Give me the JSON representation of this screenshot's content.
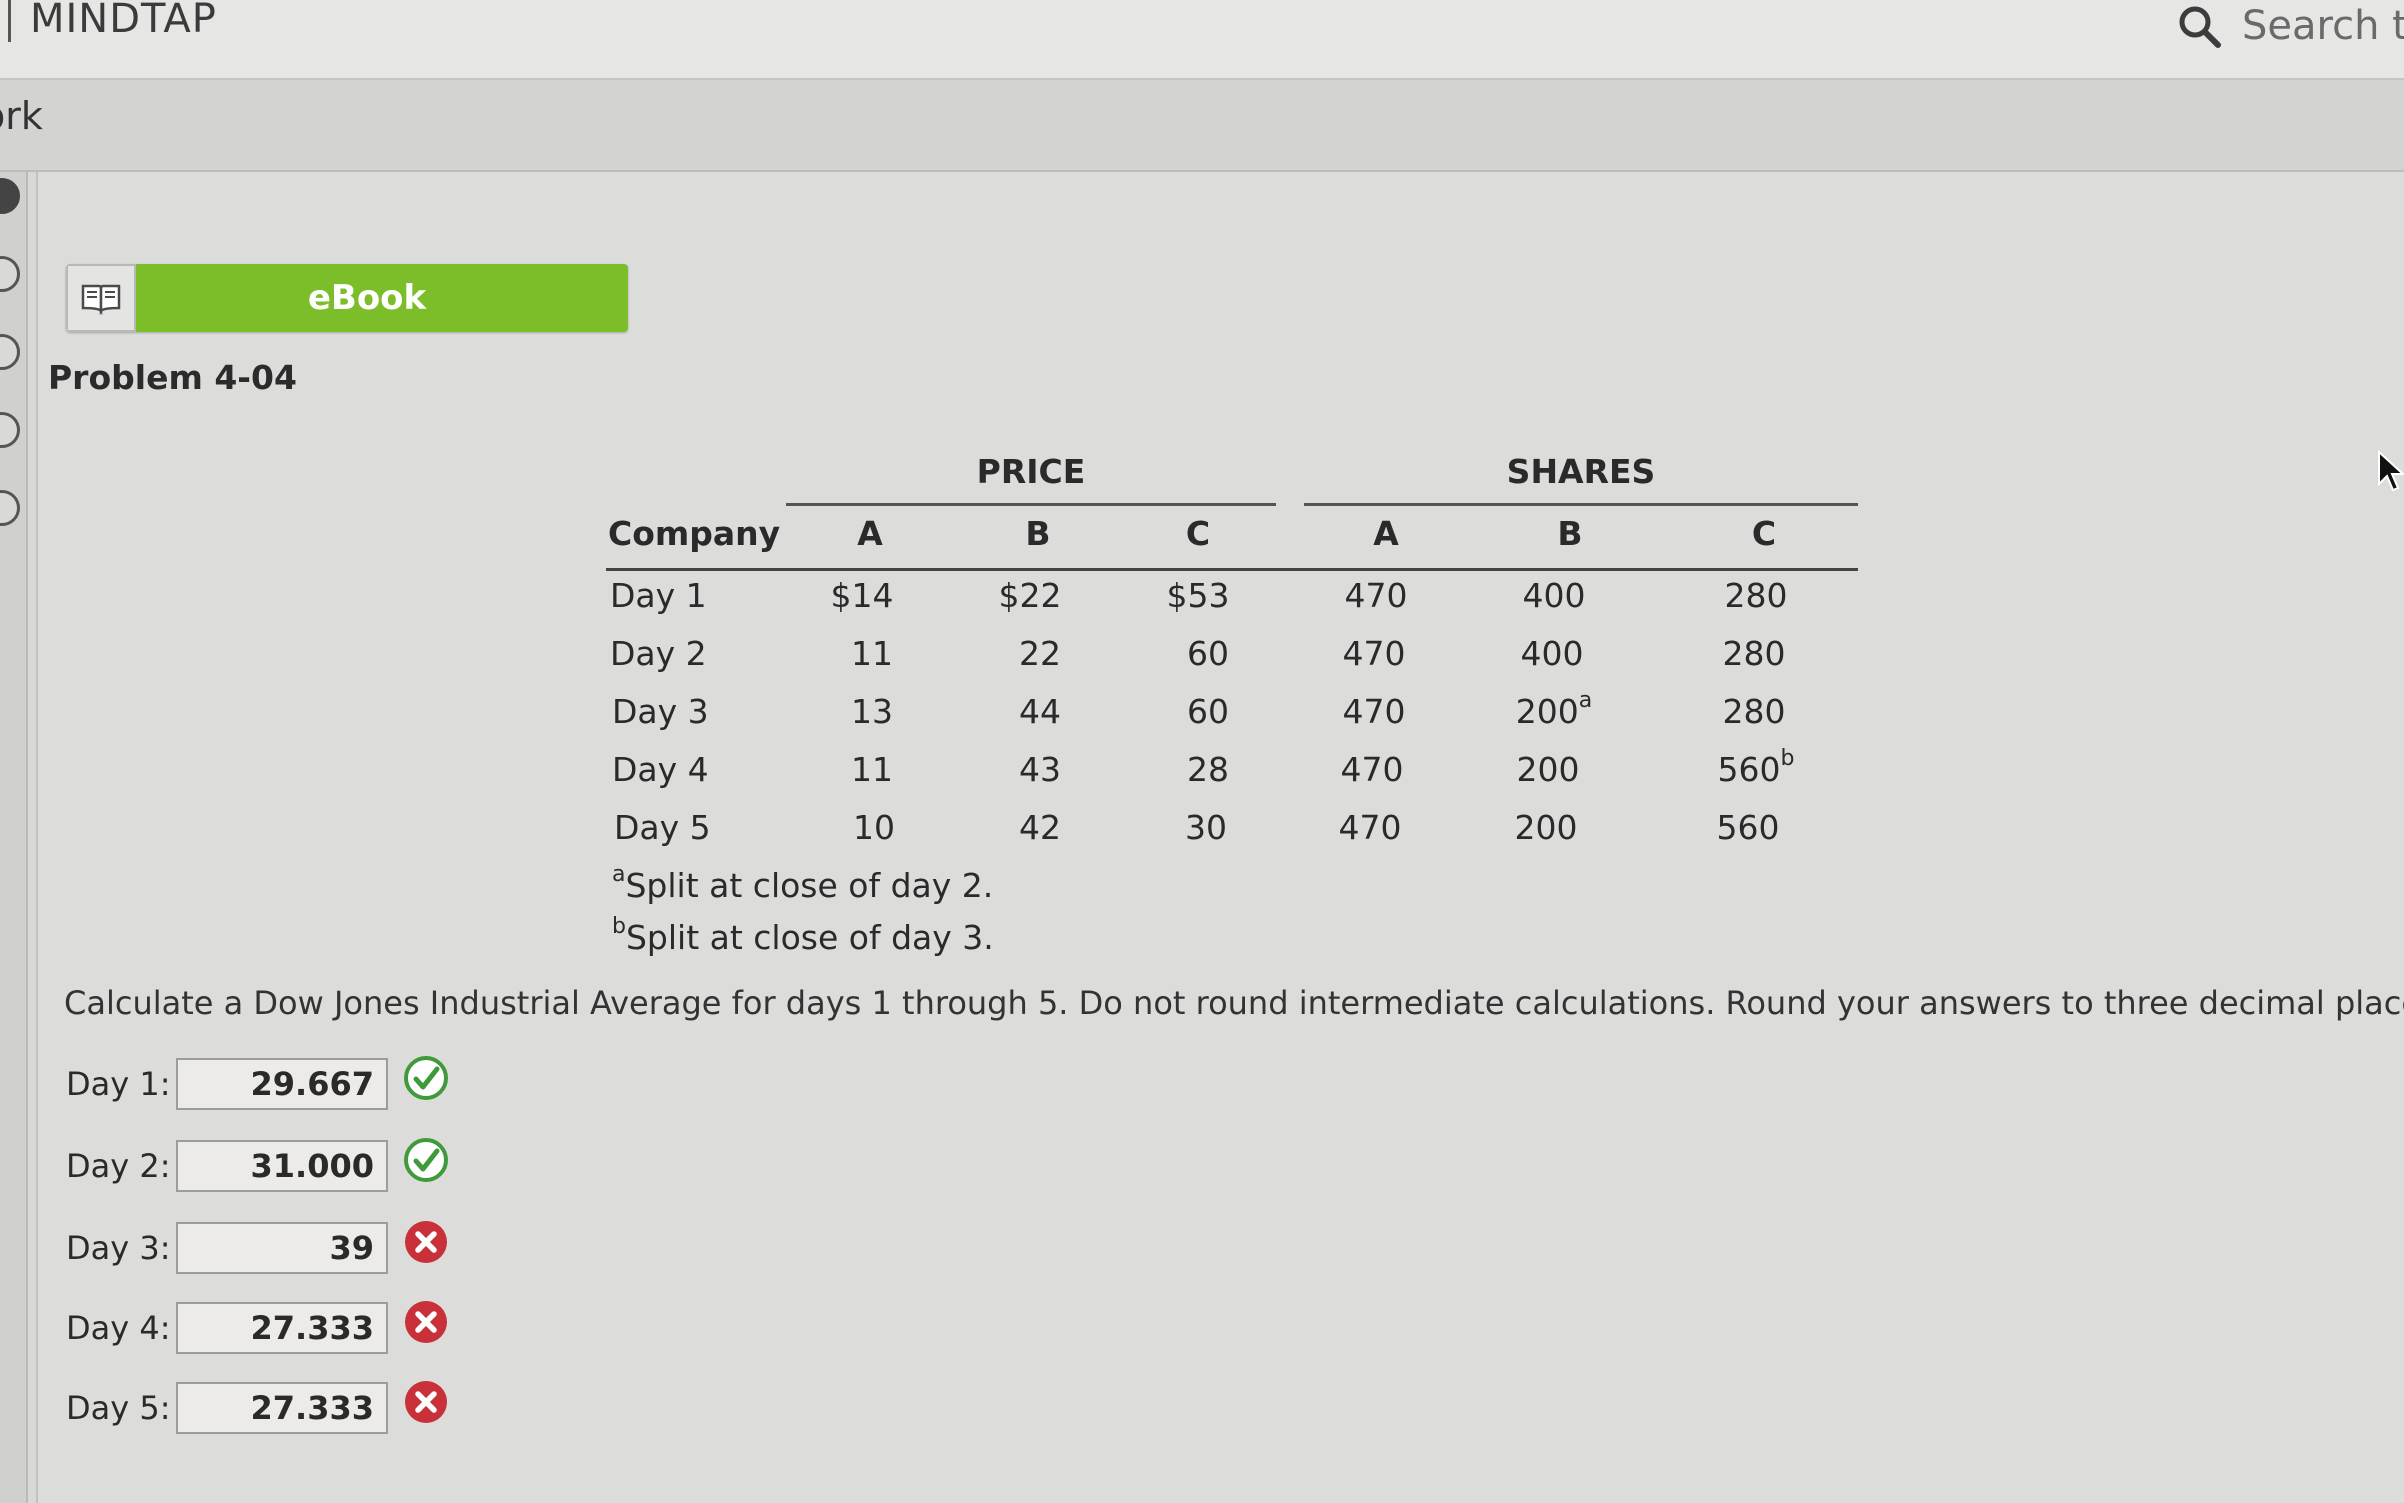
{
  "header": {
    "brand": "MINDTAP",
    "search_text": "Search th",
    "sub_title": "ork"
  },
  "ebook": {
    "label": "eBook"
  },
  "problem": {
    "title": "Problem 4-04"
  },
  "table": {
    "groups": [
      "PRICE",
      "SHARES"
    ],
    "columns": [
      "Company",
      "A",
      "B",
      "C",
      "A",
      "B",
      "C"
    ],
    "rows": [
      {
        "company": "Day 1",
        "values": [
          "$14",
          "$22",
          "$53",
          "470",
          "400",
          "280"
        ],
        "marks": [
          "",
          "",
          "",
          "",
          "",
          ""
        ]
      },
      {
        "company": "Day 2",
        "values": [
          "11",
          "22",
          "60",
          "470",
          "400",
          "280"
        ],
        "marks": [
          "",
          "",
          "",
          "",
          "",
          ""
        ]
      },
      {
        "company": "Day 3",
        "values": [
          "13",
          "44",
          "60",
          "470",
          "200",
          "280"
        ],
        "marks": [
          "",
          "",
          "",
          "",
          "a",
          ""
        ]
      },
      {
        "company": "Day 4",
        "values": [
          "11",
          "43",
          "28",
          "470",
          "200",
          "560"
        ],
        "marks": [
          "",
          "",
          "",
          "",
          "",
          "b"
        ]
      },
      {
        "company": "Day 5",
        "values": [
          "10",
          "42",
          "30",
          "470",
          "200",
          "560"
        ],
        "marks": [
          "",
          "",
          "",
          "",
          "",
          ""
        ]
      }
    ],
    "notes": [
      {
        "mark": "a",
        "text": "Split at close of day 2."
      },
      {
        "mark": "b",
        "text": "Split at close of day 3."
      }
    ]
  },
  "question": "Calculate a Dow Jones Industrial Average for days 1 through 5. Do not round intermediate calculations. Round your answers to three decimal places.",
  "answers": [
    {
      "label": "Day 1:",
      "value": "29.667",
      "status": "correct"
    },
    {
      "label": "Day 2:",
      "value": "31.000",
      "status": "correct"
    },
    {
      "label": "Day 3:",
      "value": "39",
      "status": "incorrect"
    },
    {
      "label": "Day 4:",
      "value": "27.333",
      "status": "incorrect"
    },
    {
      "label": "Day 5:",
      "value": "27.333",
      "status": "incorrect"
    }
  ],
  "colors": {
    "ebook_green": "#7cbe2a",
    "correct_green": "#3f9a3a",
    "incorrect_red": "#c8303a"
  },
  "icons": [
    "search-icon",
    "book-icon",
    "check-circle-icon",
    "x-circle-icon",
    "mouse-pointer-icon"
  ]
}
